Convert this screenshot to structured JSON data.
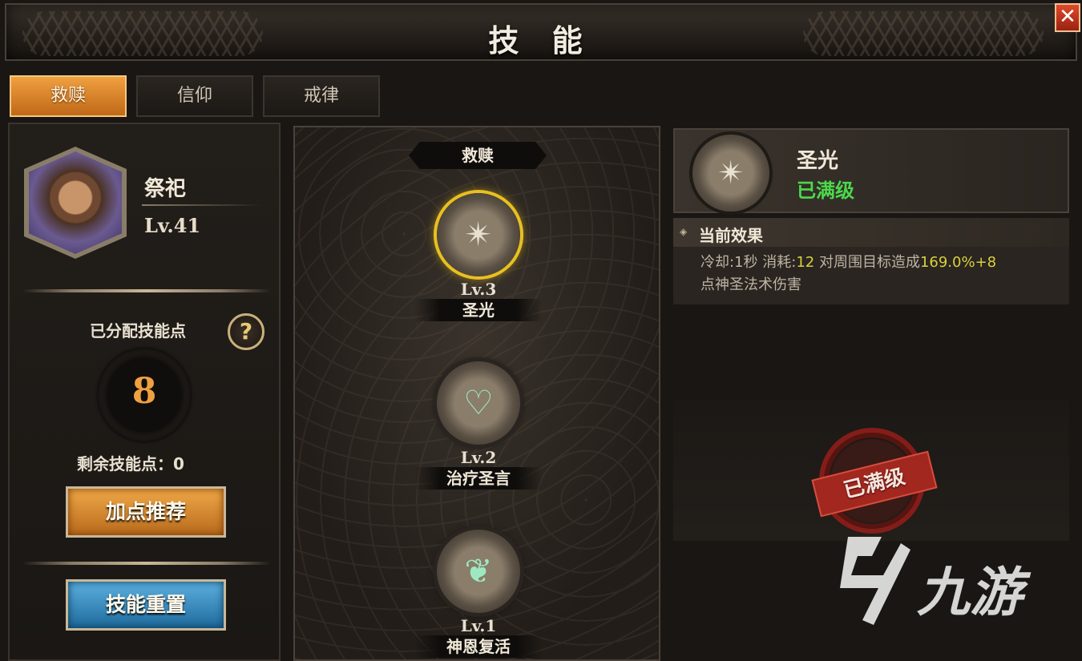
{
  "window": {
    "title": "技 能",
    "close_icon": "close-icon"
  },
  "tabs": [
    {
      "label": "救赎",
      "active": true
    },
    {
      "label": "信仰",
      "active": false
    },
    {
      "label": "戒律",
      "active": false
    }
  ],
  "character": {
    "name": "祭祀",
    "level": "Lv.41"
  },
  "points": {
    "allocated_label": "已分配技能点",
    "allocated_value": "8",
    "remaining_label": "剩余技能点：0"
  },
  "buttons": {
    "recommend": "加点推荐",
    "reset": "技能重置"
  },
  "tree": {
    "header": "救赎",
    "skills": [
      {
        "level": "Lv.3",
        "name": "圣光",
        "icon": "holy-light-icon",
        "selected": true
      },
      {
        "level": "Lv.2",
        "name": "治疗圣言",
        "icon": "heal-heart-icon",
        "selected": false
      },
      {
        "level": "Lv.1",
        "name": "神恩复活",
        "icon": "resurrect-icon",
        "selected": false
      }
    ]
  },
  "detail": {
    "name": "圣光",
    "status": "已满级",
    "effect_title": "当前效果",
    "effect_line1_a": "冷却:1秒 消耗:",
    "effect_line1_b": "12",
    "effect_line1_c": " 对周围目标造成",
    "effect_line1_d": "169.0%+8",
    "effect_line2": "点神圣法术伤害",
    "stamp": "已满级"
  },
  "watermark": {
    "text": "九游"
  },
  "colors": {
    "accent_orange": "#f0a040",
    "status_green": "#4cd84c",
    "button_blue": "#1e6a9c",
    "stamp_red": "#a82820"
  }
}
